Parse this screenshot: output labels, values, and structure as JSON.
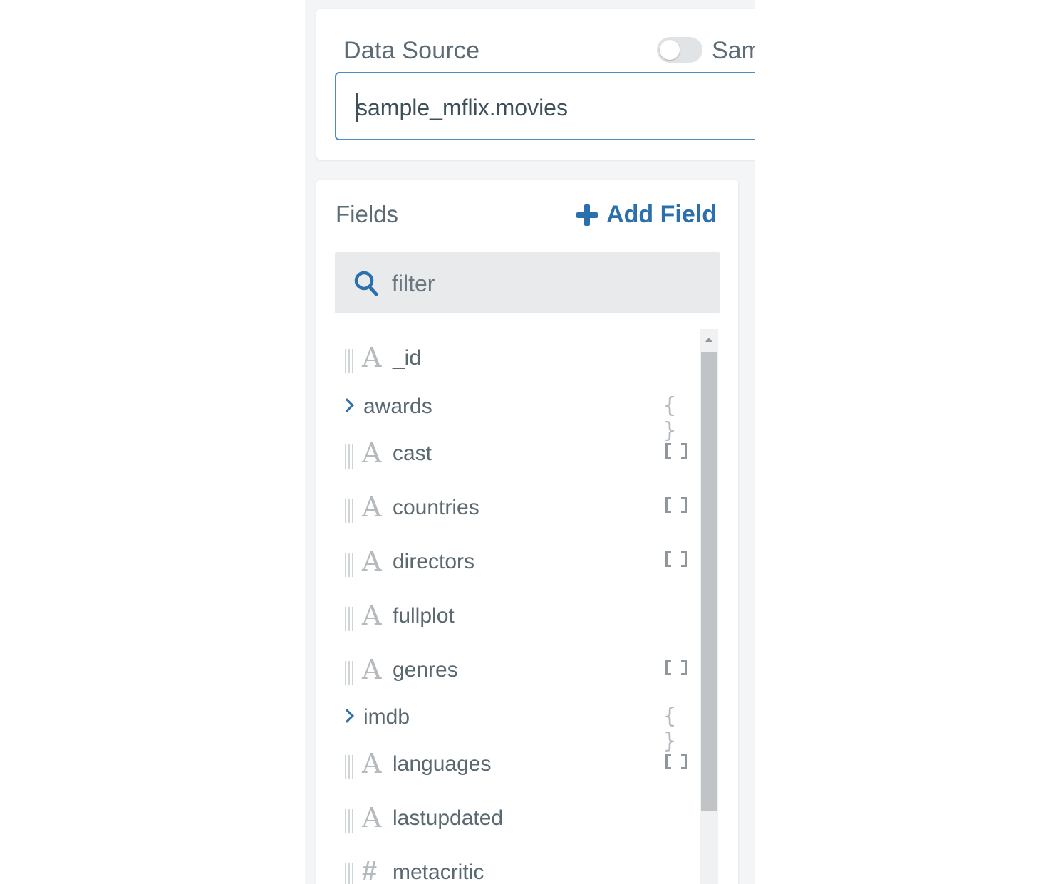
{
  "data_source": {
    "label": "Data Source",
    "toggle_label": "Sam",
    "toggle_on": false,
    "value": "sample_mflix.movies"
  },
  "fields": {
    "title": "Fields",
    "add_label": "Add Field",
    "filter_placeholder": "filter",
    "items": [
      {
        "name": "_id",
        "type": "string",
        "badge": ""
      },
      {
        "name": "awards",
        "type": "object",
        "badge": "{ }"
      },
      {
        "name": "cast",
        "type": "string",
        "badge": "array"
      },
      {
        "name": "countries",
        "type": "string",
        "badge": "array"
      },
      {
        "name": "directors",
        "type": "string",
        "badge": "array"
      },
      {
        "name": "fullplot",
        "type": "string",
        "badge": ""
      },
      {
        "name": "genres",
        "type": "string",
        "badge": "array"
      },
      {
        "name": "imdb",
        "type": "object",
        "badge": "{ }"
      },
      {
        "name": "languages",
        "type": "string",
        "badge": "array"
      },
      {
        "name": "lastupdated",
        "type": "string",
        "badge": ""
      },
      {
        "name": "metacritic",
        "type": "number",
        "badge": ""
      }
    ]
  },
  "icons": {
    "string_type": "A",
    "number_type": "#",
    "object_badge": "{ }"
  },
  "colors": {
    "accent": "#2c6fad",
    "input_border": "#4b8cc4",
    "label": "#5d6c74",
    "muted": "#b4babe"
  }
}
